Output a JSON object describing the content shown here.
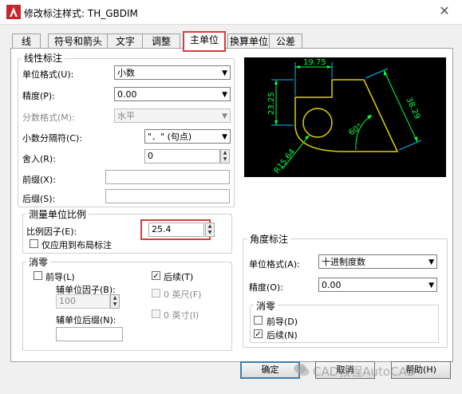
{
  "window": {
    "title": "修改标注样式: TH_GBDIM",
    "app_icon": "autocad-logo-icon",
    "close_glyph": "✕"
  },
  "tabs": [
    "线",
    "符号和箭头",
    "文字",
    "调整",
    "主单位",
    "换算单位",
    "公差"
  ],
  "active_tab": "主单位",
  "linear": {
    "title": "线性标注",
    "unit_format_label": "单位格式(U):",
    "unit_format_value": "小数",
    "precision_label": "精度(P):",
    "precision_value": "0.00",
    "fraction_format_label": "分数格式(M):",
    "fraction_format_value": "水平",
    "decimal_separator_label": "小数分隔符(C):",
    "decimal_separator_value": "\"．\" (句点)",
    "round_off_label": "舍入(R):",
    "round_off_value": "0",
    "prefix_label": "前缀(X):",
    "prefix_value": "",
    "suffix_label": "后缀(S):",
    "suffix_value": ""
  },
  "scale": {
    "title": "测量单位比例",
    "factor_label": "比例因子(E):",
    "factor_value": "25.4",
    "layout_only_label": "仅应用到布局标注",
    "layout_only_checked": false
  },
  "zero_linear": {
    "title": "消零",
    "leading_label": "前导(L)",
    "leading_checked": false,
    "trailing_label": "后续(T)",
    "trailing_checked": true,
    "sub_factor_label": "辅单位因子(B):",
    "sub_factor_value": "100",
    "feet_label": "0 英尺(F)",
    "feet_checked": false,
    "sub_suffix_label": "辅单位后缀(N):",
    "sub_suffix_value": "",
    "inches_label": "0 英寸(I)",
    "inches_checked": false
  },
  "preview": {
    "dim_top": "19.75",
    "dim_left": "23.25",
    "dim_right": "38.29",
    "dim_angle": "60°",
    "dim_radius": "R15.64",
    "colors": {
      "background": "#000000",
      "geometry": "#e0d000",
      "dimension": "#00ff40",
      "extension": "#00c0ff"
    }
  },
  "angular": {
    "title": "角度标注",
    "unit_format_label": "单位格式(A):",
    "unit_format_value": "十进制度数",
    "precision_label": "精度(O):",
    "precision_value": "0.00",
    "zero_title": "消零",
    "leading_label": "前导(D)",
    "leading_checked": false,
    "trailing_label": "后续(N)",
    "trailing_checked": true
  },
  "buttons": {
    "ok": "确定",
    "cancel": "取消",
    "help": "帮助(H)"
  },
  "watermark": {
    "text": "CAD教程AutoCAD",
    "icon": "wechat-icon"
  },
  "highlight_color": "#d83c3c"
}
